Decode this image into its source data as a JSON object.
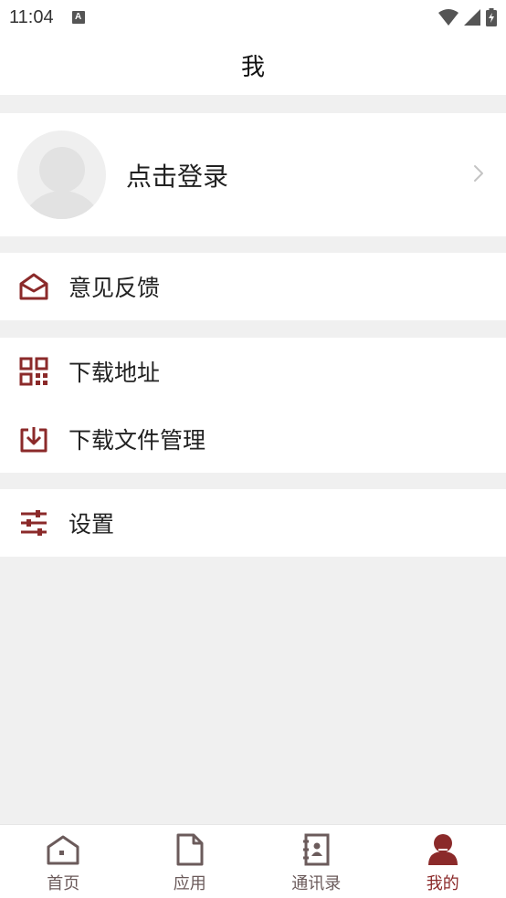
{
  "status_bar": {
    "time": "11:04",
    "notification_letter": "A"
  },
  "header": {
    "title": "我"
  },
  "profile": {
    "login_label": "点击登录"
  },
  "menu": {
    "feedback": "意见反馈",
    "download_address": "下载地址",
    "download_manager": "下载文件管理",
    "settings": "设置"
  },
  "tabs": [
    {
      "label": "首页",
      "icon": "home-icon"
    },
    {
      "label": "应用",
      "icon": "document-icon"
    },
    {
      "label": "通讯录",
      "icon": "contacts-icon"
    },
    {
      "label": "我的",
      "icon": "person-icon",
      "active": true
    }
  ],
  "colors": {
    "accent": "#8b2a2a",
    "tab_inactive": "#6b5b5b",
    "background": "#f0f0f0"
  }
}
